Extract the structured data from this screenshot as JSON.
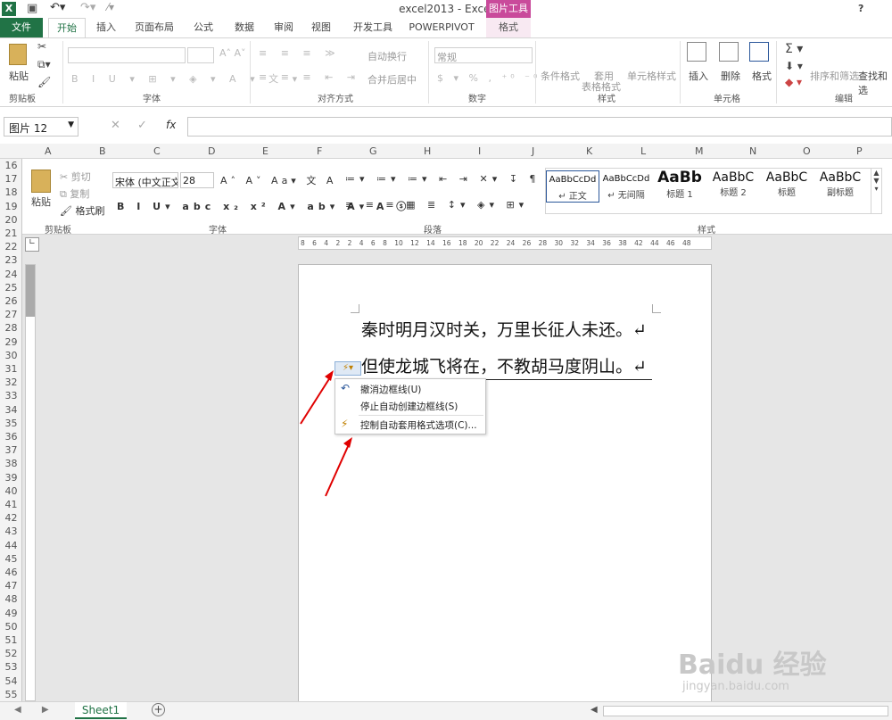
{
  "app": {
    "title": "excel2013 - Excel",
    "contextual_group": "图片工具",
    "help": "?"
  },
  "tabs": [
    "文件",
    "开始",
    "插入",
    "页面布局",
    "公式",
    "数据",
    "审阅",
    "视图",
    "开发工具",
    "POWERPIVOT",
    "格式"
  ],
  "ribbon": {
    "clipboard": {
      "paste": "粘贴",
      "group": "剪贴板"
    },
    "font": {
      "group": "字体"
    },
    "align": {
      "wrap": "自动换行",
      "merge": "合并后居中",
      "group": "对齐方式"
    },
    "number": {
      "format": "常规",
      "group": "数字"
    },
    "styles": {
      "cond": "条件格式",
      "table1": "套用",
      "table2": "表格格式",
      "cell": "单元格样式",
      "group": "样式"
    },
    "cells": {
      "insert": "插入",
      "delete": "删除",
      "format": "格式",
      "group": "单元格"
    },
    "editing": {
      "sort": "排序和筛选",
      "find": "查找和选",
      "group": "编辑"
    }
  },
  "formula_bar": {
    "namebox": "图片 12",
    "fx": "fx"
  },
  "columns": [
    "A",
    "B",
    "C",
    "D",
    "E",
    "F",
    "G",
    "H",
    "I",
    "J",
    "K",
    "L",
    "M",
    "N",
    "O",
    "P"
  ],
  "rows": [
    "16",
    "17",
    "18",
    "19",
    "20",
    "21",
    "22",
    "23",
    "24",
    "25",
    "26",
    "27",
    "28",
    "29",
    "30",
    "31",
    "32",
    "33",
    "34",
    "35",
    "36",
    "37",
    "38",
    "39",
    "40",
    "41",
    "42",
    "43",
    "44",
    "45",
    "46",
    "47",
    "48",
    "49",
    "50",
    "51",
    "52",
    "53",
    "54",
    "55"
  ],
  "word": {
    "clipboard": {
      "paste": "粘贴",
      "cut": "剪切",
      "copy": "复制",
      "painter": "格式刷",
      "group": "剪贴板"
    },
    "font": {
      "name": "宋体 (中文正文",
      "size": "28",
      "group": "字体"
    },
    "para_group": "段落",
    "styles": [
      {
        "sample": "AaBbCcDd",
        "name": "↵ 正文"
      },
      {
        "sample": "AaBbCcDd",
        "name": "↵ 无间隔"
      },
      {
        "sample": "AaBb",
        "name": "标题 1"
      },
      {
        "sample": "AaBbC",
        "name": "标题 2"
      },
      {
        "sample": "AaBbC",
        "name": "标题"
      },
      {
        "sample": "AaBbC",
        "name": "副标题"
      }
    ],
    "styles_group": "样式",
    "ruler": "8 6 4 2 2 4 6 8 10 12 14 16 18 20 22 24 26 28 30 32 34 36 38 42 44 46 48",
    "doc": {
      "line1": "秦时明月汉时关，万里长征人未还。↵",
      "line2": "但使龙城飞将在，不教胡马度阴山。↵"
    },
    "menu": [
      "撤消边框线(U)",
      "停止自动创建边框线(S)",
      "控制自动套用格式选项(C)..."
    ]
  },
  "sheet": {
    "tab": "Sheet1",
    "add": "+"
  },
  "watermark": {
    "line1": "Baidu 经验",
    "line2": "jingyan.baidu.com"
  },
  "colors": {
    "file_tab": "#217346",
    "accent": "#217346",
    "context": "#c94a9b",
    "arrow": "#e00000"
  }
}
